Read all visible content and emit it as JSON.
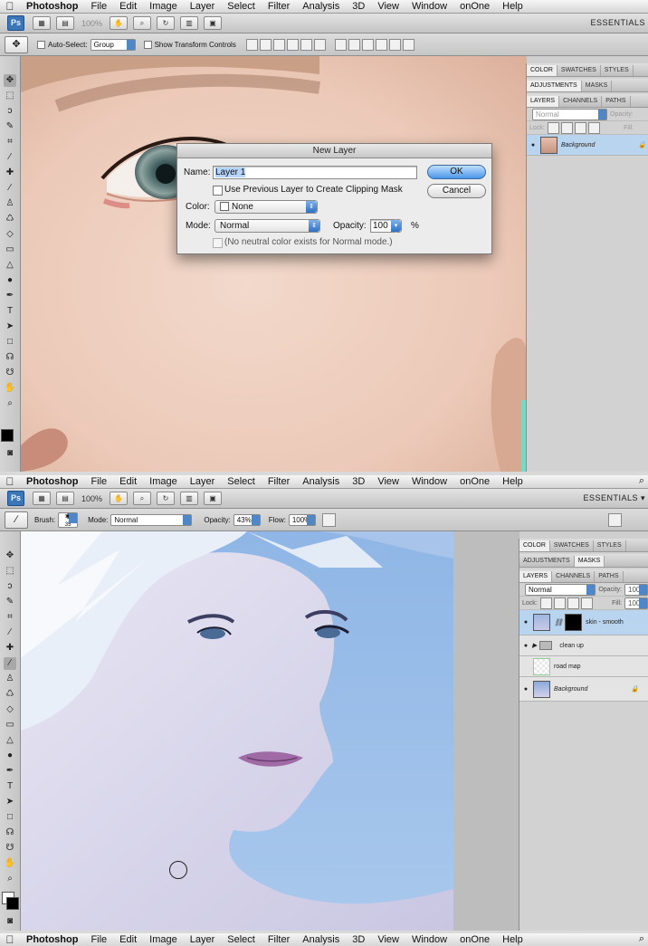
{
  "menu": {
    "apple": "⌘",
    "app": "Photoshop",
    "items": [
      "File",
      "Edit",
      "Image",
      "Layer",
      "Select",
      "Filter",
      "Analysis",
      "3D",
      "View",
      "Window",
      "onOne",
      "Help"
    ]
  },
  "top": {
    "ps_badge": "Ps",
    "zoom": "100%",
    "essentials": "ESSENTIALS",
    "options": {
      "auto_select": "Auto-Select:",
      "auto_select_value": "Group",
      "show_transform": "Show Transform Controls"
    },
    "panel_tabs_1": [
      "COLOR",
      "SWATCHES",
      "STYLES"
    ],
    "panel_tabs_2": [
      "ADJUSTMENTS",
      "MASKS"
    ],
    "panel_tabs_3": [
      "LAYERS",
      "CHANNELS",
      "PATHS"
    ],
    "blend": "Normal",
    "opacity_label": "Opacity:",
    "lock_label": "Lock:",
    "fill_label": "Fill:",
    "layers": [
      {
        "name": "Background"
      }
    ]
  },
  "dialog": {
    "title": "New Layer",
    "name_label": "Name:",
    "name_value": "Layer 1",
    "clip_label": "Use Previous Layer to Create Clipping Mask",
    "color_label": "Color:",
    "color_value": "None",
    "mode_label": "Mode:",
    "mode_value": "Normal",
    "opacity_label": "Opacity:",
    "opacity_value": "100",
    "percent": "%",
    "neutral_label": "(No neutral color exists for Normal mode.)",
    "ok": "OK",
    "cancel": "Cancel"
  },
  "bottom": {
    "ps_badge": "Ps",
    "zoom": "100%",
    "essentials": "ESSENTIALS ▾",
    "options": {
      "brush_label": "Brush:",
      "brush_size": "35",
      "mode_label": "Mode:",
      "mode_value": "Normal",
      "opacity_label": "Opacity:",
      "opacity_value": "43%",
      "flow_label": "Flow:",
      "flow_value": "100%"
    },
    "panel_tabs_1": [
      "COLOR",
      "SWATCHES",
      "STYLES"
    ],
    "panel_tabs_2": [
      "ADJUSTMENTS",
      "MASKS"
    ],
    "panel_tabs_3": [
      "LAYERS",
      "CHANNELS",
      "PATHS"
    ],
    "blend": "Normal",
    "opacity_label": "Opacity:",
    "opacity_value": "100%",
    "lock_label": "Lock:",
    "fill_label": "Fill:",
    "fill_value": "100%",
    "layers": [
      {
        "name": "skin - smooth"
      },
      {
        "name": "clean up"
      },
      {
        "name": "road map"
      },
      {
        "name": "Background"
      }
    ]
  },
  "colors": {
    "accent": "#3d76b7",
    "selection": "#b9d4ef",
    "button_blue": "#4b95e8"
  }
}
